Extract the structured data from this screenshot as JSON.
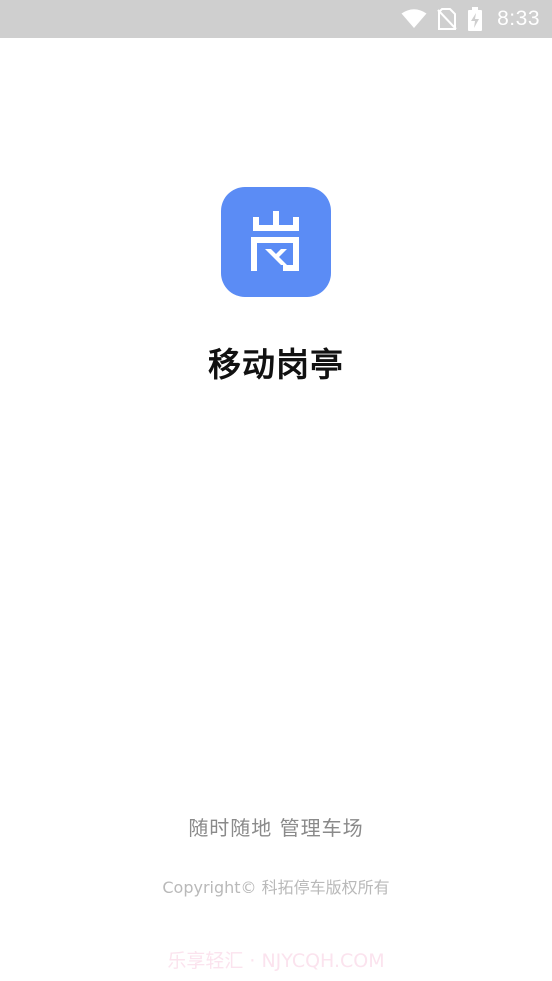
{
  "status_bar": {
    "time": "8:33",
    "icons": [
      "wifi-icon",
      "no-sim-icon",
      "battery-charging-icon"
    ]
  },
  "app": {
    "name": "移动岗亭",
    "logo_color": "#5b8cf5",
    "logo_icon": "gang-character-logo"
  },
  "footer": {
    "slogan": "随时随地 管理车场",
    "copyright": "Copyright© 科拓停车版权所有",
    "watermark": "乐享轻汇 · NJYCQH.COM"
  }
}
